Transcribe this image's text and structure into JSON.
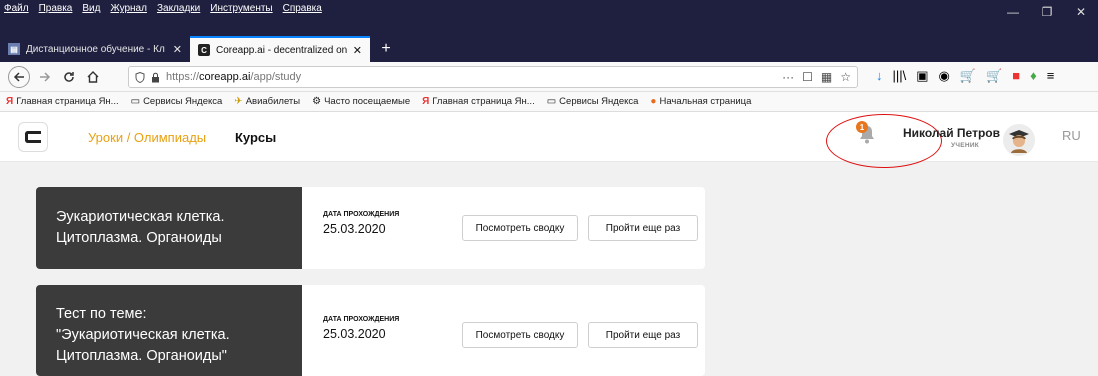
{
  "browser": {
    "menu": [
      "Файл",
      "Правка",
      "Вид",
      "Журнал",
      "Закладки",
      "Инструменты",
      "Справка"
    ],
    "window_controls": [
      "—",
      "❐",
      "✕"
    ],
    "tabs": [
      {
        "label": "Дистанционное обучение - Кл",
        "close": "✕"
      },
      {
        "label": "Coreapp.ai - decentralized onli",
        "close": "✕"
      }
    ],
    "new_tab": "+",
    "url": {
      "scheme": "https://",
      "host": "coreapp.ai",
      "path": "/app/study"
    },
    "url_actions": [
      "···",
      "☐",
      "▦",
      "☆"
    ],
    "toolbar_icons": [
      "↓",
      "|||\\",
      "▣",
      "◉",
      "🛒",
      "🛒",
      "■",
      "♦",
      "≡"
    ],
    "bookmarks": [
      {
        "icon": "Я",
        "label": "Главная страница Ян..."
      },
      {
        "icon": "▭",
        "label": "Сервисы Яндекса"
      },
      {
        "icon": "✈",
        "label": "Авиабилеты"
      },
      {
        "icon": "⚙",
        "label": "Часто посещаемые"
      },
      {
        "icon": "Я",
        "label": "Главная страница Ян..."
      },
      {
        "icon": "▭",
        "label": "Сервисы Яндекса"
      },
      {
        "icon": "●",
        "label": "Начальная страница"
      }
    ]
  },
  "app": {
    "nav_active": "Уроки / Олимпиады",
    "nav_courses": "Курсы",
    "notification_count": "1",
    "user_name": "Николай Петров",
    "user_role": "УЧЕНИК",
    "lang": "RU"
  },
  "cards": [
    {
      "title": "Эукариотическая клетка.\nЦитоплазма. Органоиды",
      "date_label": "ДАТА ПРОХОЖДЕНИЯ",
      "date": "25.03.2020",
      "summary_button": "Посмотреть сводку",
      "retry_button": "Пройти еще раз"
    },
    {
      "title": "Тест по теме:\n\"Эукариотическая клетка.\nЦитоплазма. Органоиды\"",
      "date_label": "ДАТА ПРОХОЖДЕНИЯ",
      "date": "25.03.2020",
      "summary_button": "Посмотреть сводку",
      "retry_button": "Пройти еще раз"
    }
  ],
  "colors": {
    "accent": "#e8a112",
    "badge": "#e8761c",
    "card_dark": "#3b3b3b",
    "annotation": "#dd1111"
  }
}
